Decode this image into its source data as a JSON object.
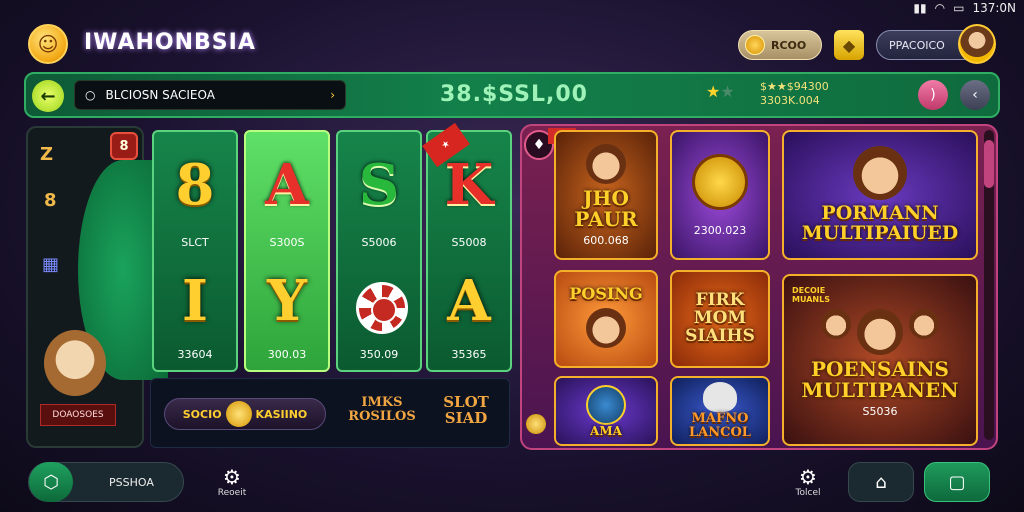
{
  "status_bar": {
    "signal": "▮▮▮",
    "wifi": "wifi",
    "time": "137:0N"
  },
  "header": {
    "title": "IWAHONBSIA",
    "coin_label": "RCOO",
    "profile_label": "PPACOICO"
  },
  "nav": {
    "search_placeholder": "BLCIOSN SACIEOA",
    "balance": "38.$SSL,00",
    "jackpot_line1": "$★★$94300",
    "jackpot_line2": "3303K.004"
  },
  "slot": {
    "side_label": "DOAOSOES",
    "reels": [
      {
        "top_symbol": "8",
        "top_label": "SLCT",
        "bottom_symbol": "I",
        "bottom_label": "33604"
      },
      {
        "top_symbol": "A",
        "top_label": "S300S",
        "bottom_symbol": "Y",
        "bottom_label": "300.03"
      },
      {
        "top_symbol": "S",
        "top_label": "S5006",
        "bottom_symbol": "",
        "bottom_label": "350.09"
      },
      {
        "top_symbol": "K",
        "top_label": "S5008",
        "bottom_symbol": "A",
        "bottom_label": "35365"
      }
    ],
    "strip_badge_left": "SOCIO",
    "strip_badge_right": "KASIINO",
    "strip_text_1": "IMKS\nROSILOS",
    "strip_text_2": "SLOT\nSIAD"
  },
  "games": [
    {
      "title": "JHO\nPAUR",
      "sub": "600.068"
    },
    {
      "title": "",
      "sub": "2300.023"
    },
    {
      "title": "PORMANN\nMULTIPAIUED",
      "sub": ""
    },
    {
      "title": "POSING",
      "sub": ""
    },
    {
      "title": "FIRK\nMOM\nSIAIHS",
      "sub": ""
    },
    {
      "title": "POENSAINS\nMULTIPANEN",
      "sub": "S5036",
      "tag": "DECOIE\nMUANLS"
    },
    {
      "title": "AMA",
      "sub": ""
    },
    {
      "title": "MAFNO\nLANCOL",
      "sub": ""
    }
  ],
  "bottom_bar": {
    "home_label": "PSSHOA",
    "settings_label": "Reoeit",
    "settings2_label": "Tolcel"
  }
}
